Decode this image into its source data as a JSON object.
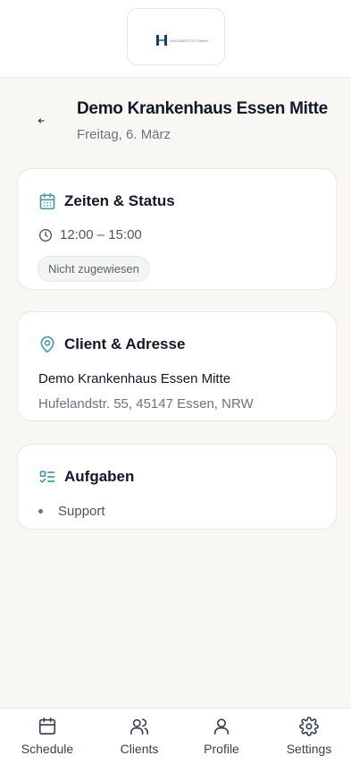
{
  "header": {
    "logo_text": "HAUSARZT24 GmbH",
    "title": "Demo Krankenhaus Essen Mitte",
    "subtitle": "Freitag, 6. März"
  },
  "times_card": {
    "title": "Zeiten & Status",
    "time_range": "12:00 – 15:00",
    "status_badge": "Nicht zugewiesen"
  },
  "client_card": {
    "title": "Client & Adresse",
    "client_name": "Demo Krankenhaus Essen Mitte",
    "address": "Hufelandstr. 55, 45147 Essen, NRW"
  },
  "tasks_card": {
    "title": "Aufgaben",
    "items": [
      "Support"
    ]
  },
  "bottom_nav": {
    "items": [
      {
        "label": "Schedule",
        "icon": "calendar-icon"
      },
      {
        "label": "Clients",
        "icon": "users-icon"
      },
      {
        "label": "Profile",
        "icon": "user-icon"
      },
      {
        "label": "Settings",
        "icon": "gear-icon"
      }
    ]
  },
  "colors": {
    "accent": "#4a97a8",
    "background": "#f8f7f4",
    "card": "#ffffff",
    "text_primary": "#111827",
    "text_secondary": "#6b7280"
  }
}
